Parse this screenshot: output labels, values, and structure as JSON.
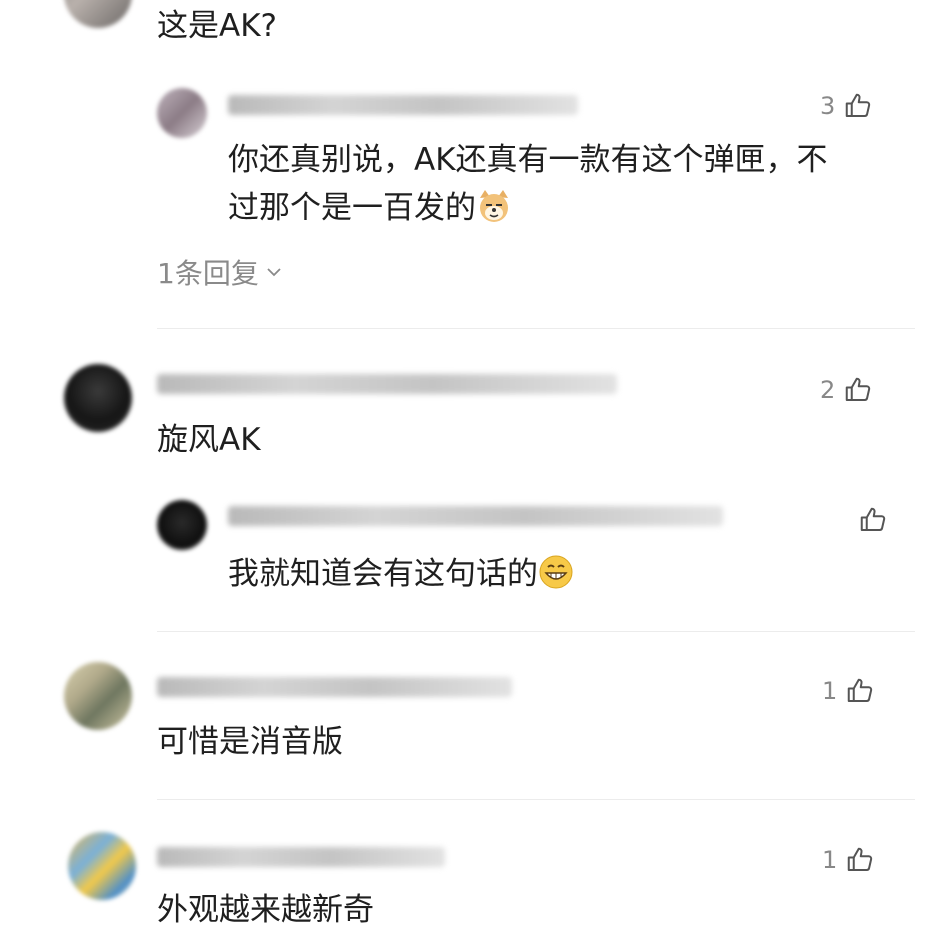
{
  "comments": [
    {
      "text": "这是AK?"
    },
    {
      "text_line1": "你还真别说，AK还真有一款有这个弹匣，不",
      "text_line2": "过那个是一百发的",
      "likes": "3"
    },
    {
      "replies_label": "1条回复"
    },
    {
      "text": "旋风AK",
      "likes": "2"
    },
    {
      "text": "我就知道会有这句话的",
      "likes": ""
    },
    {
      "text": "可惜是消音版",
      "likes": "1"
    },
    {
      "text": "外观越来越新奇",
      "likes": "1"
    }
  ],
  "icons": {
    "like": "thumbs-up-outline-icon",
    "expand": "chevron-down-icon",
    "emoji_dog": "doge-emoji-icon",
    "emoji_grin": "grinning-emoji-icon"
  },
  "colors": {
    "divider": "#ececec",
    "muted": "#888888",
    "text": "#1f1f1f"
  }
}
